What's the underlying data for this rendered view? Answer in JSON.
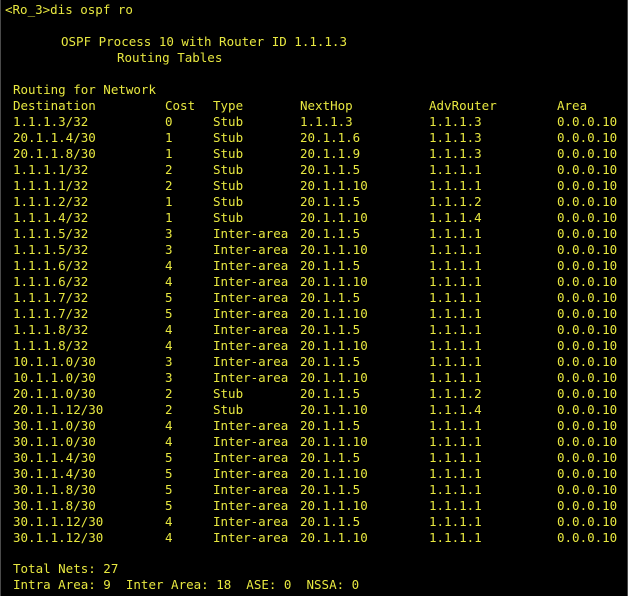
{
  "window": {
    "prompt": "<Ro_3>dis ospf ro"
  },
  "banner": {
    "line1": "OSPF Process 10 with Router ID 1.1.1.3",
    "line2": "Routing Tables"
  },
  "section_title": "Routing for Network",
  "table": {
    "headers": [
      "Destination",
      "Cost",
      "Type",
      "NextHop",
      "AdvRouter",
      "Area"
    ],
    "rows": [
      [
        "1.1.1.3/32",
        "0",
        "Stub",
        "1.1.1.3",
        "1.1.1.3",
        "0.0.0.10"
      ],
      [
        "20.1.1.4/30",
        "1",
        "Stub",
        "20.1.1.6",
        "1.1.1.3",
        "0.0.0.10"
      ],
      [
        "20.1.1.8/30",
        "1",
        "Stub",
        "20.1.1.9",
        "1.1.1.3",
        "0.0.0.10"
      ],
      [
        "1.1.1.1/32",
        "2",
        "Stub",
        "20.1.1.5",
        "1.1.1.1",
        "0.0.0.10"
      ],
      [
        "1.1.1.1/32",
        "2",
        "Stub",
        "20.1.1.10",
        "1.1.1.1",
        "0.0.0.10"
      ],
      [
        "1.1.1.2/32",
        "1",
        "Stub",
        "20.1.1.5",
        "1.1.1.2",
        "0.0.0.10"
      ],
      [
        "1.1.1.4/32",
        "1",
        "Stub",
        "20.1.1.10",
        "1.1.1.4",
        "0.0.0.10"
      ],
      [
        "1.1.1.5/32",
        "3",
        "Inter-area",
        "20.1.1.5",
        "1.1.1.1",
        "0.0.0.10"
      ],
      [
        "1.1.1.5/32",
        "3",
        "Inter-area",
        "20.1.1.10",
        "1.1.1.1",
        "0.0.0.10"
      ],
      [
        "1.1.1.6/32",
        "4",
        "Inter-area",
        "20.1.1.5",
        "1.1.1.1",
        "0.0.0.10"
      ],
      [
        "1.1.1.6/32",
        "4",
        "Inter-area",
        "20.1.1.10",
        "1.1.1.1",
        "0.0.0.10"
      ],
      [
        "1.1.1.7/32",
        "5",
        "Inter-area",
        "20.1.1.5",
        "1.1.1.1",
        "0.0.0.10"
      ],
      [
        "1.1.1.7/32",
        "5",
        "Inter-area",
        "20.1.1.10",
        "1.1.1.1",
        "0.0.0.10"
      ],
      [
        "1.1.1.8/32",
        "4",
        "Inter-area",
        "20.1.1.5",
        "1.1.1.1",
        "0.0.0.10"
      ],
      [
        "1.1.1.8/32",
        "4",
        "Inter-area",
        "20.1.1.10",
        "1.1.1.1",
        "0.0.0.10"
      ],
      [
        "10.1.1.0/30",
        "3",
        "Inter-area",
        "20.1.1.5",
        "1.1.1.1",
        "0.0.0.10"
      ],
      [
        "10.1.1.0/30",
        "3",
        "Inter-area",
        "20.1.1.10",
        "1.1.1.1",
        "0.0.0.10"
      ],
      [
        "20.1.1.0/30",
        "2",
        "Stub",
        "20.1.1.5",
        "1.1.1.2",
        "0.0.0.10"
      ],
      [
        "20.1.1.12/30",
        "2",
        "Stub",
        "20.1.1.10",
        "1.1.1.4",
        "0.0.0.10"
      ],
      [
        "30.1.1.0/30",
        "4",
        "Inter-area",
        "20.1.1.5",
        "1.1.1.1",
        "0.0.0.10"
      ],
      [
        "30.1.1.0/30",
        "4",
        "Inter-area",
        "20.1.1.10",
        "1.1.1.1",
        "0.0.0.10"
      ],
      [
        "30.1.1.4/30",
        "5",
        "Inter-area",
        "20.1.1.5",
        "1.1.1.1",
        "0.0.0.10"
      ],
      [
        "30.1.1.4/30",
        "5",
        "Inter-area",
        "20.1.1.10",
        "1.1.1.1",
        "0.0.0.10"
      ],
      [
        "30.1.1.8/30",
        "5",
        "Inter-area",
        "20.1.1.5",
        "1.1.1.1",
        "0.0.0.10"
      ],
      [
        "30.1.1.8/30",
        "5",
        "Inter-area",
        "20.1.1.10",
        "1.1.1.1",
        "0.0.0.10"
      ],
      [
        "30.1.1.12/30",
        "4",
        "Inter-area",
        "20.1.1.5",
        "1.1.1.1",
        "0.0.0.10"
      ],
      [
        "30.1.1.12/30",
        "4",
        "Inter-area",
        "20.1.1.10",
        "1.1.1.1",
        "0.0.0.10"
      ]
    ]
  },
  "totals": {
    "line1": "Total Nets: 27",
    "line2": "Intra Area: 9  Inter Area: 18  ASE: 0  NSSA: 0"
  },
  "colors": {
    "background": "#000000",
    "text": "#e8e840"
  }
}
